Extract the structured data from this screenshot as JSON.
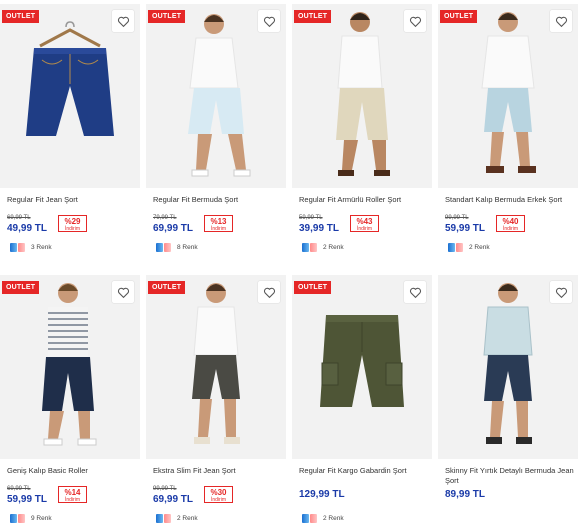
{
  "outlet_label": "OUTLET",
  "discount_label": "İndirim",
  "colors": {
    "price": "#1a3aa8",
    "badge": "#e52727"
  },
  "products": [
    {
      "title": "Regular Fit Jean Şort",
      "outlet": true,
      "old_price": "69,99 TL",
      "price": "49,99 TL",
      "discount": "%29",
      "colors": "3 Renk",
      "type": "jean"
    },
    {
      "title": "Regular Fit Bermuda Şort",
      "outlet": true,
      "old_price": "79,99 TL",
      "price": "69,99 TL",
      "discount": "%13",
      "colors": "8 Renk",
      "type": "model-light"
    },
    {
      "title": "Regular Fit Armürlü Roller Şort",
      "outlet": true,
      "old_price": "59,99 TL",
      "price": "39,99 TL",
      "discount": "%43",
      "colors": "2 Renk",
      "type": "model-beige"
    },
    {
      "title": "Standart Kalıp Bermuda Erkek Şort",
      "outlet": true,
      "old_price": "99,99 TL",
      "price": "59,99 TL",
      "discount": "%40",
      "colors": "2 Renk",
      "type": "model-lightblue"
    },
    {
      "title": "Geniş Kalıp Basic Roller",
      "outlet": true,
      "old_price": "69,99 TL",
      "price": "59,99 TL",
      "discount": "%14",
      "colors": "9 Renk",
      "type": "model-navy"
    },
    {
      "title": "Ekstra Slim Fit Jean Şort",
      "outlet": true,
      "old_price": "99,99 TL",
      "price": "69,99 TL",
      "discount": "%30",
      "colors": "2 Renk",
      "type": "model-grey"
    },
    {
      "title": "Regular Fit Kargo Gabardin Şort",
      "outlet": true,
      "old_price": "",
      "price": "129,99 TL",
      "discount": "",
      "colors": "2 Renk",
      "type": "cargo"
    },
    {
      "title": "Skinny Fit Yırtık Detaylı Bermuda Jean Şort",
      "outlet": false,
      "old_price": "",
      "price": "89,99 TL",
      "discount": "",
      "colors": "",
      "type": "model-denim"
    }
  ]
}
